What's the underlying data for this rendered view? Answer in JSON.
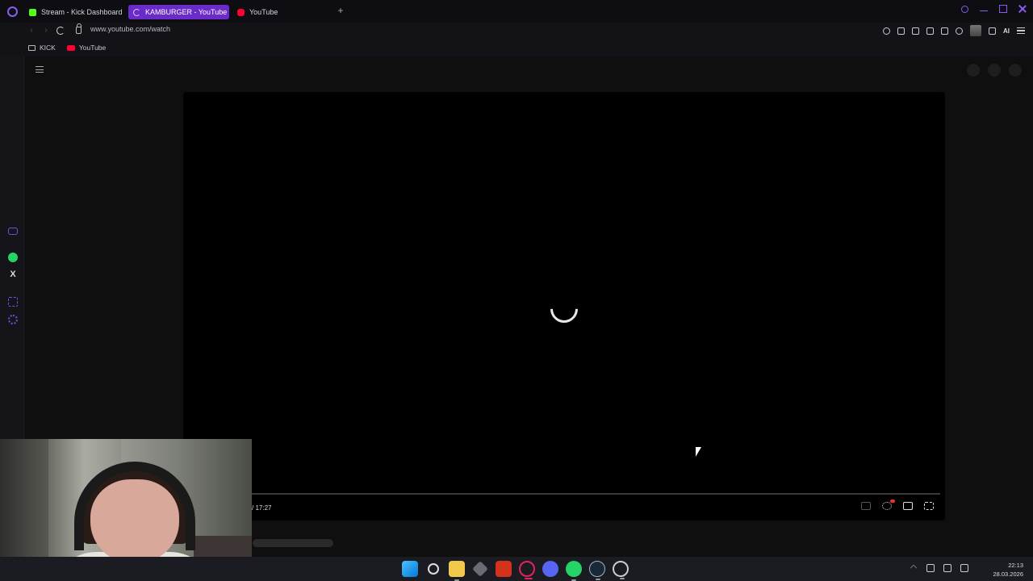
{
  "tabs": [
    {
      "label": "Stream - Kick Dashboard",
      "favicon": "kick-icon",
      "active": false
    },
    {
      "label": "KAMBURGER - YouTube",
      "favicon": "loading-spinner-icon",
      "active": true
    },
    {
      "label": "YouTube",
      "favicon": "youtube-icon",
      "active": false
    }
  ],
  "address": {
    "url": "www.youtube.com/watch"
  },
  "bookmarks": [
    {
      "label": "KICK",
      "icon": "folder-icon"
    },
    {
      "label": "YouTube",
      "icon": "youtube-icon"
    }
  ],
  "player": {
    "time_display": "/ 17:27",
    "state": "loading"
  },
  "taskbar": {
    "apps": [
      "windows-start-icon",
      "search-icon",
      "file-explorer-icon",
      "cube-icon",
      "amd-icon",
      "opera-icon",
      "discord-icon",
      "whatsapp-icon",
      "steam-icon",
      "obs-icon"
    ],
    "clock_time": "22:13",
    "clock_date": "28.03.2026"
  },
  "colors": {
    "accent": "#6a2bc9",
    "opera": "#8a5cf0",
    "youtube": "#ff0033",
    "kick": "#53fc18"
  }
}
